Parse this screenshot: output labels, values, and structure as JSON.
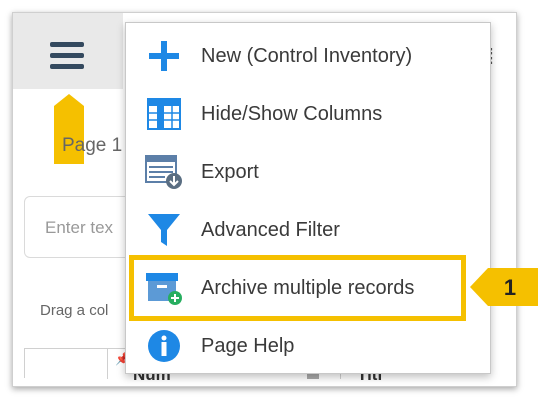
{
  "page": {
    "page_label": "Page 1",
    "search_placeholder": "Enter tex",
    "drag_label": "Drag a col",
    "grid": {
      "col_number": "Num",
      "col_title": "Titl"
    }
  },
  "menu": {
    "items": [
      {
        "label": "New (Control Inventory)",
        "icon": "plus-icon"
      },
      {
        "label": "Hide/Show Columns",
        "icon": "columns-icon"
      },
      {
        "label": "Export",
        "icon": "export-icon"
      },
      {
        "label": "Advanced Filter",
        "icon": "filter-icon"
      },
      {
        "label": "Archive multiple records",
        "icon": "archive-icon"
      },
      {
        "label": "Page Help",
        "icon": "info-icon"
      }
    ]
  },
  "callout": {
    "number": "1"
  },
  "colors": {
    "accent_blue": "#1e88e5",
    "highlight_yellow": "#f5c000",
    "hamburger": "#34495e",
    "archive_green": "#27ae60"
  }
}
